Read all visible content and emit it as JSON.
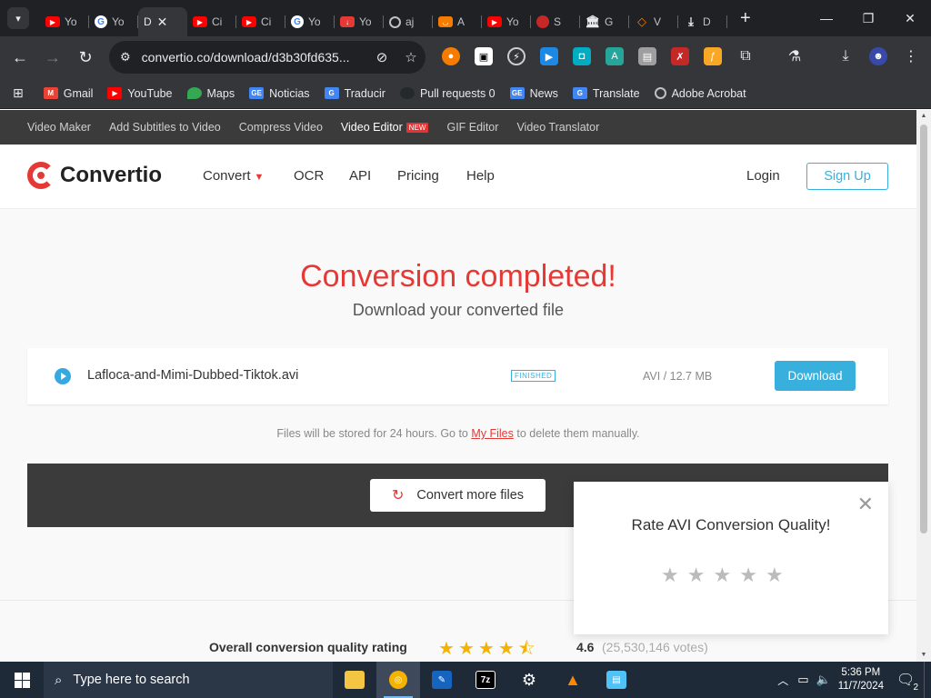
{
  "browser": {
    "tabs": [
      {
        "label": "Yo",
        "icon": "youtube-icon"
      },
      {
        "label": "Yo",
        "icon": "google-icon"
      },
      {
        "label": "D",
        "icon": "none",
        "active": true
      },
      {
        "label": "Ci",
        "icon": "youtube-icon"
      },
      {
        "label": "Ci",
        "icon": "youtube-icon"
      },
      {
        "label": "Yo",
        "icon": "google-icon"
      },
      {
        "label": "Yo",
        "icon": "download-red-icon"
      },
      {
        "label": "aj",
        "icon": "globe-icon"
      },
      {
        "label": "A",
        "icon": "orange-app-icon"
      },
      {
        "label": "Yo",
        "icon": "youtube-icon"
      },
      {
        "label": "S",
        "icon": "red-circle-icon"
      },
      {
        "label": "G",
        "icon": "museum-icon"
      },
      {
        "label": "V",
        "icon": "diamond-icon"
      },
      {
        "label": "D",
        "icon": "download-icon"
      }
    ],
    "url": "convertio.co/download/d3b30fd635...",
    "bookmarks": [
      {
        "label": "Gmail",
        "icon": "gmail-icon",
        "color": "#ea4335"
      },
      {
        "label": "YouTube",
        "icon": "youtube-icon",
        "color": "#ff0000"
      },
      {
        "label": "Maps",
        "icon": "maps-icon",
        "color": "#34a853"
      },
      {
        "label": "Noticias",
        "icon": "news-icon",
        "color": "#4285f4"
      },
      {
        "label": "Traducir",
        "icon": "translate-icon",
        "color": "#4285f4"
      },
      {
        "label": "Pull requests 0",
        "icon": "github-icon",
        "color": "#24292e"
      },
      {
        "label": "News",
        "icon": "news-icon",
        "color": "#4285f4"
      },
      {
        "label": "Translate",
        "icon": "translate-icon",
        "color": "#4285f4"
      },
      {
        "label": "Adobe Acrobat",
        "icon": "globe-icon",
        "color": "#5f6368"
      }
    ]
  },
  "site": {
    "topnav": [
      {
        "label": "Video Maker"
      },
      {
        "label": "Add Subtitles to Video"
      },
      {
        "label": "Compress Video"
      },
      {
        "label": "Video Editor",
        "badge": "NEW"
      },
      {
        "label": "GIF Editor"
      },
      {
        "label": "Video Translator"
      }
    ],
    "logo": "Convertio",
    "mainnav": {
      "convert": "Convert",
      "ocr": "OCR",
      "api": "API",
      "pricing": "Pricing",
      "help": "Help"
    },
    "login": "Login",
    "signup": "Sign Up",
    "hero": {
      "title": "Conversion completed!",
      "subtitle": "Download your converted file"
    },
    "file": {
      "name": "Lafloca-and-Mimi-Dubbed-Tiktok.avi",
      "status": "FINISHED",
      "meta": "AVI / 12.7 MB",
      "download": "Download"
    },
    "storage": {
      "before": "Files will be stored for 24 hours. Go to ",
      "link": "My Files",
      "after": " to delete them manually."
    },
    "convert_more": "Convert more files",
    "rating": {
      "label": "Overall conversion quality rating",
      "score": "4.6",
      "votes": "(25,530,146 votes)",
      "stars_value": 4.6
    },
    "popup": {
      "title": "Rate AVI Conversion Quality!",
      "stars": 5
    }
  },
  "taskbar": {
    "search_placeholder": "Type here to search",
    "time": "5:36 PM",
    "date": "11/7/2024",
    "notifications": "2"
  },
  "colors": {
    "accent_red": "#e53935",
    "accent_blue": "#38b0de",
    "star": "#f5b301"
  }
}
